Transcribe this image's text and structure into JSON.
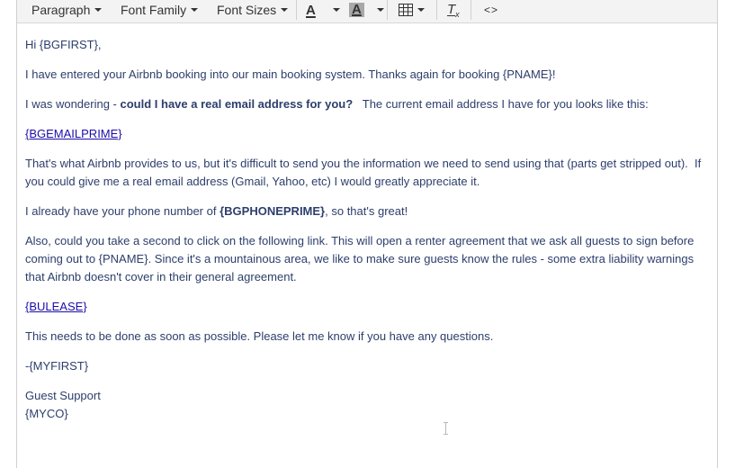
{
  "toolbar": {
    "paragraph_label": "Paragraph",
    "font_family_label": "Font Family",
    "font_sizes_label": "Font Sizes",
    "text_color_glyph": "A",
    "bg_color_glyph": "A",
    "clear_format_glyph": "T",
    "clear_format_sub": "x",
    "source_code_glyph": "<>",
    "icons": [
      "chevron-down-icon",
      "text-color-icon",
      "background-color-icon",
      "table-icon",
      "clear-formatting-icon",
      "source-code-icon"
    ]
  },
  "body": {
    "greeting": "Hi {BGFIRST},",
    "p2": "I have entered your Airbnb booking into our main booking system. Thanks again for booking {PNAME}!",
    "p3_prefix": "I was wondering - ",
    "p3_bold": "could I have a real email address for you?",
    "p3_suffix": "   The current email address I have for you looks like this:",
    "email_link": "{BGEMAILPRIME}",
    "p5_line1": "That's what Airbnb provides to us, but it's difficult to send you the information we need to send using that (parts get stripped out).  If",
    "p5_line2": "you could give me a real email address (Gmail, Yahoo, etc) I would greatly appreciate it.",
    "p6_prefix": "I already have your phone number of ",
    "p6_bold": "{BGPHONEPRIME}",
    "p6_suffix": ", so that's great!",
    "p7_line1": "Also, could you take a second to click on the following link. This will open a renter agreement that we ask all guests to sign before",
    "p7_line2": "coming out to {PNAME}. Since it's a mountainous area, we like to make sure guests know the rules - some extra liability warnings",
    "p7_line3": "that Airbnb doesn't cover in their general agreement.",
    "lease_link": "{BULEASE}",
    "p9": "This needs to be done as soon as possible. Please let me know if you have any questions.",
    "signoff": "-{MYFIRST}",
    "sig_line1": "Guest Support",
    "sig_line2": "{MYCO}"
  },
  "colors": {
    "body_text": "#2c3e6b",
    "link": "#1a0dab",
    "toolbar_bg": "#f3f3f3"
  }
}
